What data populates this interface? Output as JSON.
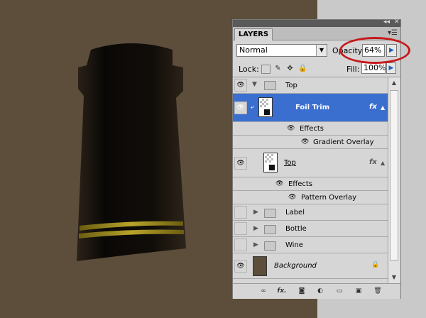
{
  "panel": {
    "tab_label": "LAYERS",
    "blend_mode": "Normal",
    "opacity_label": "Opacity:",
    "opacity_value": "64%",
    "lock_label": "Lock:",
    "fill_label": "Fill:",
    "fill_value": "100%"
  },
  "layers": [
    {
      "name": "Top",
      "type": "group",
      "visible": true,
      "expanded": true
    },
    {
      "name": "Foil Trim",
      "type": "layer",
      "visible": true,
      "selected": true,
      "fx": "fx"
    },
    {
      "name": "Effects",
      "type": "effects-header"
    },
    {
      "name": "Gradient Overlay",
      "type": "effect"
    },
    {
      "name": "Top",
      "type": "layer",
      "visible": true,
      "fx": "fx"
    },
    {
      "name": "Effects",
      "type": "effects-header"
    },
    {
      "name": "Pattern Overlay",
      "type": "effect"
    },
    {
      "name": "Label",
      "type": "group",
      "visible": false
    },
    {
      "name": "Bottle",
      "type": "group",
      "visible": false
    },
    {
      "name": "Wine",
      "type": "group",
      "visible": false
    },
    {
      "name": "Background",
      "type": "background",
      "visible": true,
      "locked": true
    }
  ],
  "colors": {
    "canvas": "#5c4e3b",
    "selection": "#3a6fd0",
    "highlight_oval": "#c8191b"
  },
  "icons": [
    "eye-icon",
    "folder-icon",
    "lock-icon",
    "link-icon",
    "fx-icon",
    "mask-icon",
    "adjustment-icon",
    "new-group-icon",
    "new-layer-icon",
    "trash-icon"
  ]
}
